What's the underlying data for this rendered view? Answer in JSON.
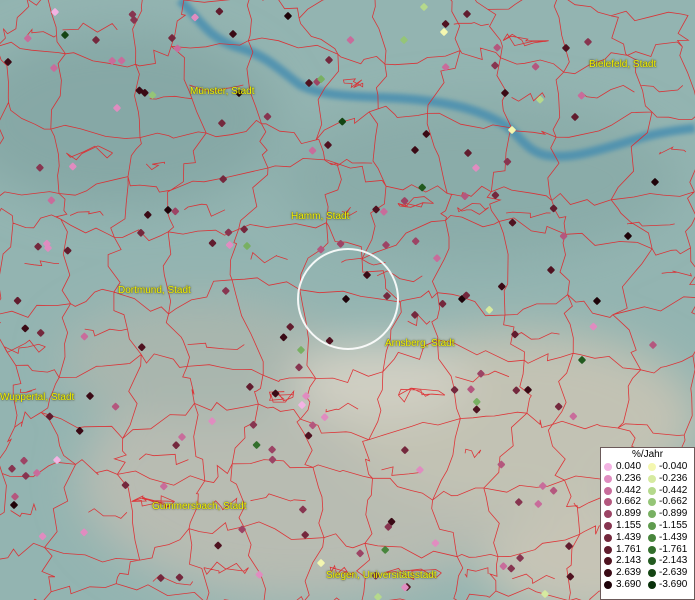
{
  "cities": [
    {
      "label": "Münster, Stadt"
    },
    {
      "label": "Bielefeld, Stadt"
    },
    {
      "label": "Hamm, Stadt"
    },
    {
      "label": "Dortmund, Stadt"
    },
    {
      "label": "Arnsberg, Stadt"
    },
    {
      "label": "Wuppertal, Stadt"
    },
    {
      "label": "Gummersbach, Stadt"
    },
    {
      "label": "Siegen, Universitätsstadt"
    }
  ],
  "legend": {
    "title": "%/Jahr",
    "positive": [
      {
        "value": "0.040",
        "color": "#f3b3e3"
      },
      {
        "value": "0.236",
        "color": "#e08cc0"
      },
      {
        "value": "0.442",
        "color": "#c86c9b"
      },
      {
        "value": "0.662",
        "color": "#b4577e"
      },
      {
        "value": "0.899",
        "color": "#9c4465"
      },
      {
        "value": "1.155",
        "color": "#873550"
      },
      {
        "value": "1.439",
        "color": "#74283d"
      },
      {
        "value": "1.761",
        "color": "#611c2e"
      },
      {
        "value": "2.143",
        "color": "#4f1220"
      },
      {
        "value": "2.639",
        "color": "#3a0a15"
      },
      {
        "value": "3.690",
        "color": "#1e0309"
      }
    ],
    "negative": [
      {
        "value": "-0.040",
        "color": "#f4f7b0"
      },
      {
        "value": "-0.236",
        "color": "#d6eaa0"
      },
      {
        "value": "-0.442",
        "color": "#b5d98c"
      },
      {
        "value": "-0.662",
        "color": "#95c577"
      },
      {
        "value": "-0.899",
        "color": "#78b062"
      },
      {
        "value": "-1.155",
        "color": "#5f9b4e"
      },
      {
        "value": "-1.439",
        "color": "#48853c"
      },
      {
        "value": "-1.761",
        "color": "#336f2c"
      },
      {
        "value": "-2.143",
        "color": "#225a1f"
      },
      {
        "value": "-2.639",
        "color": "#144513"
      },
      {
        "value": "-3.690",
        "color": "#08300a"
      }
    ]
  }
}
